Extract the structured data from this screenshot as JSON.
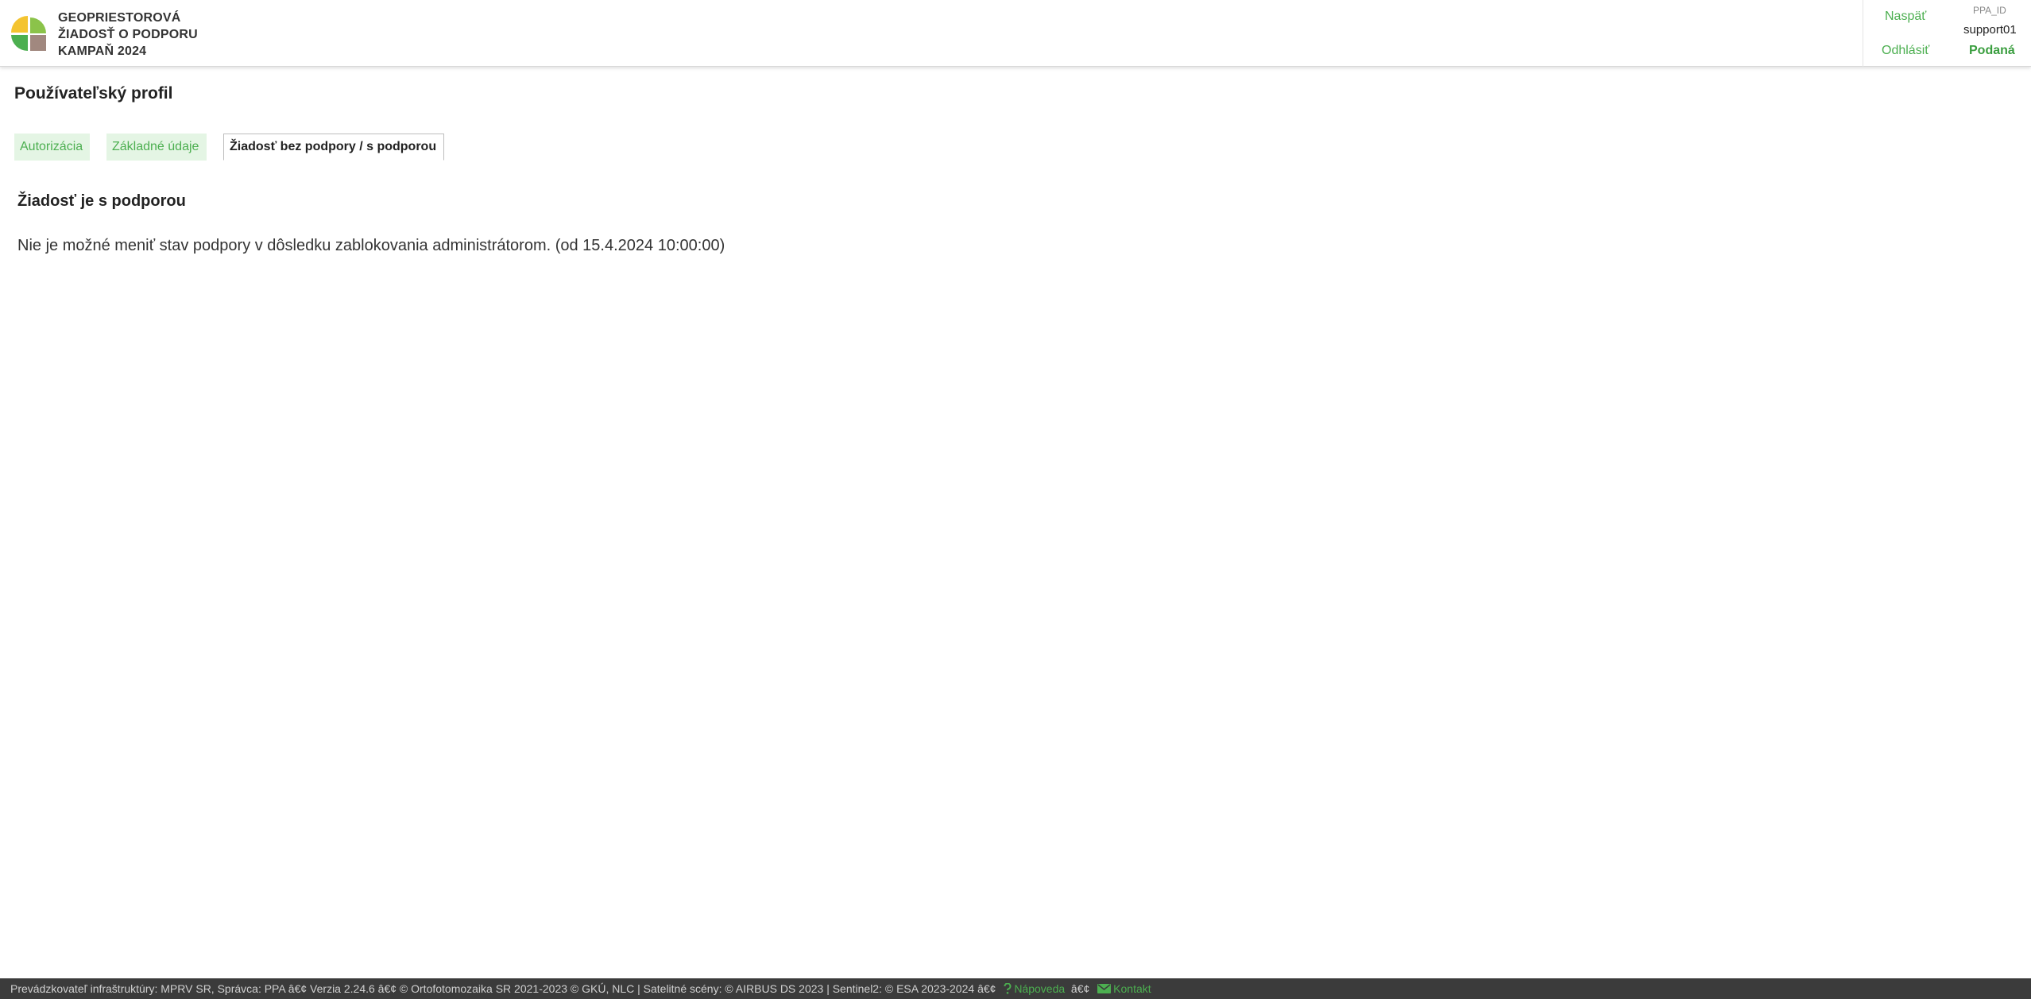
{
  "header": {
    "title_lines": [
      "GEOPRIESTOROVÁ",
      "ŽIADOSŤ O PODPORU",
      "KAMPAŇ 2024"
    ],
    "back_label": "Naspäť",
    "logout_label": "Odhlásiť",
    "ppa_label": "PPA_ID",
    "user": "support01",
    "status": "Podaná",
    "accent_color": "#4caf50"
  },
  "page": {
    "title": "Používateľský profil",
    "tabs": [
      {
        "label": "Autorizácia",
        "active": false
      },
      {
        "label": "Základné údaje",
        "active": false
      },
      {
        "label": "Žiadosť bez podpory / s podporou",
        "active": true
      }
    ],
    "section_title": "Žiadosť je s podporou",
    "message": "Nie je možné meniť stav podpory v dôsledku zablokovania administrátorom. (od 15.4.2024 10:00:00)"
  },
  "footer": {
    "text": "Prevádzkovateľ infraštruktúry: MPRV SR, Správca: PPA â€¢ Verzia 2.24.6 â€¢ © Ortofotomozaika SR 2021-2023 © GKÚ, NLC | Satelitné scény: © AIRBUS DS 2023 | Sentinel2: © ESA 2023-2024 ",
    "separator": "â€¢",
    "help_label": "Nápoveda",
    "contact_label": "Kontakt",
    "help_icon": "question-icon",
    "contact_icon": "mail-icon"
  }
}
